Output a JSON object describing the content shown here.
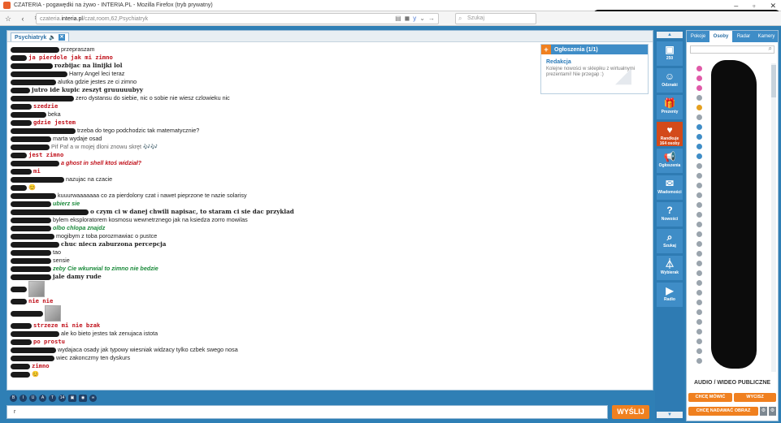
{
  "window": {
    "title": "CZATERIA - pogawędki na żywo - INTERIA.PL - Mozilla Firefox (tryb prywatny)",
    "controls": [
      "–",
      "▫",
      "✕"
    ]
  },
  "browser": {
    "url_prefix": "czateria.",
    "url_host": "interia.pl",
    "url_path": "/czat,room,62,Psychiatryk",
    "search_placeholder": "Szukaj"
  },
  "chat": {
    "tab_label": "Psychiatryk",
    "messages": [
      {
        "nick_w": 60,
        "text": "przepraszam",
        "style": ""
      },
      {
        "nick_w": 20,
        "text": "ja pierdole jak mi zimno",
        "style": "red"
      },
      {
        "nick_w": 52,
        "text": "rozbijac na linijki lol",
        "style": "bold"
      },
      {
        "nick_w": 70,
        "text": "Harry Angel leci teraz",
        "style": ""
      },
      {
        "nick_w": 56,
        "text": "alutka gdzie jestes ze ci zimno",
        "style": ""
      },
      {
        "nick_w": 24,
        "text": "jutro ide kupic zeszyt gruuuuubyy",
        "style": "bold"
      },
      {
        "nick_w": 78,
        "text": "zero dystansu do siebie, nic o sobie nie wiesz czlowieku nic",
        "style": ""
      },
      {
        "nick_w": 26,
        "text": "szedzie",
        "style": "red"
      },
      {
        "nick_w": 44,
        "text": "beka",
        "style": ""
      },
      {
        "nick_w": 26,
        "text": "gdzie jestem",
        "style": "red"
      },
      {
        "nick_w": 80,
        "text": "trzeba do tego podchodzic tak matematycznie?",
        "style": ""
      },
      {
        "nick_w": 50,
        "text": "marta wydaje osad",
        "style": ""
      },
      {
        "nick_w": 48,
        "text": "Pif Paf a w mojej dloni znowu skręt 🎶🎶",
        "style": "grey"
      },
      {
        "nick_w": 20,
        "text": "jest zimno",
        "style": "red"
      },
      {
        "nick_w": 60,
        "text": "a ghost in shell ktoś widział?",
        "style": "redb"
      },
      {
        "nick_w": 26,
        "text": "mi",
        "style": "red"
      },
      {
        "nick_w": 66,
        "text": "nazujac na czacie",
        "style": ""
      },
      {
        "nick_w": 20,
        "text": "😊",
        "style": ""
      },
      {
        "nick_w": 56,
        "text": "kuuurwaaaaaaa co za  pierdolony czat i nawet pieprzone te nazie solarisy",
        "style": ""
      },
      {
        "nick_w": 50,
        "text": "ubierz sie",
        "style": "green"
      },
      {
        "nick_w": 96,
        "text": "o czym ci w danej chwili napisac, to staram ci sie dac przyklad",
        "style": "bold"
      },
      {
        "nick_w": 50,
        "text": "bylem eksploratorem kosmosu wewnetrznego jak na ksiedza zorro mowilas",
        "style": ""
      },
      {
        "nick_w": 50,
        "text": "olbo chlopa znajdz",
        "style": "green"
      },
      {
        "nick_w": 54,
        "text": "mogibym z toba porozmawiac o pustce",
        "style": ""
      },
      {
        "nick_w": 60,
        "text": "chuc niecn zaburzona percepcja",
        "style": "bold"
      },
      {
        "nick_w": 50,
        "text": "tao",
        "style": ""
      },
      {
        "nick_w": 50,
        "text": "sensie",
        "style": ""
      },
      {
        "nick_w": 50,
        "text": "zeby Cie wkurwial to zimno nie bedzie",
        "style": "green"
      },
      {
        "nick_w": 50,
        "text": "jale damy rude",
        "style": "bold"
      }
    ],
    "image_msg_1": {
      "nick_w": 20
    },
    "line_after_img1": {
      "nick_w": 20,
      "text": "nie nie",
      "style": "red"
    },
    "image_msg_2": {
      "nick_w": 40
    },
    "tail": [
      {
        "nick_w": 26,
        "text": "strzeze mi nie bzak",
        "style": "red"
      },
      {
        "nick_w": 60,
        "text": "ale ko bieto jestes tak zenujaca istota",
        "style": ""
      },
      {
        "nick_w": 26,
        "text": "po prostu",
        "style": "red"
      },
      {
        "nick_w": 56,
        "text": "wydajaca osady jak typowy wiesniak widzacy tylko czbek swego nosa",
        "style": ""
      },
      {
        "nick_w": 54,
        "text": "wiec zakonczmy ten dyskurs",
        "style": ""
      },
      {
        "nick_w": 24,
        "text": "zimno",
        "style": "red"
      },
      {
        "nick_w": 24,
        "text": "😊",
        "style": ""
      }
    ]
  },
  "announcement": {
    "header": "Ogłoszenia (1/1)",
    "title": "Redakcja",
    "text": "Kolejne nowości w sklepiku z wirtualnymi prezentami! Nie przegap :)"
  },
  "toolbar": {
    "buttons": [
      "B",
      "I",
      "U",
      "A",
      "T",
      "14"
    ],
    "input_value": "r",
    "send_label": "WYŚLIJ"
  },
  "sidebar_mid": [
    {
      "icon": "▣",
      "label": "250",
      "name": "wallet"
    },
    {
      "icon": "☺",
      "label": "Odznaki",
      "name": "badges"
    },
    {
      "icon": "🎁",
      "label": "Prezenty",
      "name": "gifts"
    },
    {
      "icon": "♥",
      "label": "Randkuje 164 osoby",
      "name": "dating",
      "hot": true
    },
    {
      "icon": "📢",
      "label": "Ogłoszenia",
      "name": "announcements"
    },
    {
      "icon": "✉",
      "label": "Wiadomości",
      "name": "messages"
    },
    {
      "icon": "?",
      "label": "Nowości",
      "name": "news"
    },
    {
      "icon": "⌕",
      "label": "Szukaj",
      "name": "search"
    },
    {
      "icon": "⏃",
      "label": "Wybierak",
      "name": "filter"
    },
    {
      "icon": "▶",
      "label": "Radio",
      "name": "radio"
    }
  ],
  "right": {
    "tabs": [
      "Pokoje",
      "Osoby",
      "Radar",
      "Kamery"
    ],
    "active_tab": "Osoby",
    "av_title": "AUDIO / WIDEO PUBLICZNE",
    "btn_speak": "CHCĘ MÓWIĆ",
    "btn_mute": "WYCISZ",
    "btn_broadcast": "CHCĘ NADAWAĆ OBRAZ"
  }
}
